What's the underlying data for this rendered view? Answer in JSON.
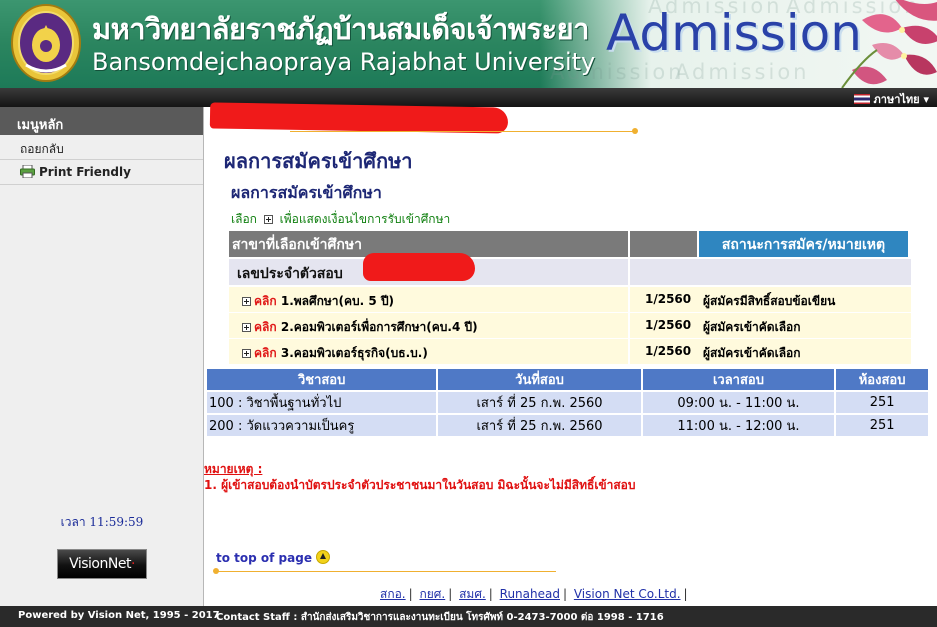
{
  "header": {
    "title_th": "มหาวิทยาลัยราชภัฏบ้านสมเด็จเจ้าพระยา",
    "title_en": "Bansomdejchaopraya Rajabhat University",
    "admission": "Admission",
    "ghost_text": "Admission"
  },
  "topbar": {
    "language": "ภาษาไทย",
    "flag_icon": "thai-flag-icon"
  },
  "sidebar": {
    "menu_heading": "เมนูหลัก",
    "back_link": "ถอยกลับ",
    "print_link": "Print Friendly",
    "clock": "เวลา 11:59:59",
    "vision_logo": "VisionNet"
  },
  "main": {
    "page_title": "ผลการสมัครเข้าศึกษา",
    "sub_title": "ผลการสมัครเข้าศึกษา",
    "select_prefix": "เลือก",
    "select_suffix": "เพื่อแสดงเงื่อนไขการรับเข้าศึกษา",
    "header_major": "สาขาที่เลือกเข้าศึกษา",
    "header_status": "สถานะการสมัคร/หมายเหตุ",
    "exam_id_label": "เลขประจำตัวสอบ",
    "click_label": "คลิก",
    "choices": [
      {
        "name": "1.พลศึกษา(คบ. 5 ปี)",
        "term": "1/2560",
        "status": "ผู้สมัครมีสิทธิ์สอบข้อเขียน"
      },
      {
        "name": "2.คอมพิวเตอร์เพื่อการศึกษา(คบ.4 ปี)",
        "term": "1/2560",
        "status": "ผู้สมัครเข้าคัดเลือก"
      },
      {
        "name": "3.คอมพิวเตอร์ธุรกิจ(บธ.บ.)",
        "term": "1/2560",
        "status": "ผู้สมัครเข้าคัดเลือก"
      }
    ],
    "exam_table": {
      "headers": [
        "วิชาสอบ",
        "วันที่สอบ",
        "เวลาสอบ",
        "ห้องสอบ"
      ],
      "rows": [
        [
          "100 : วิชาพื้นฐานทั่วไป",
          "เสาร์ ที่ 25 ก.พ. 2560",
          "09:00 น. - 11:00 น.",
          "251"
        ],
        [
          "200 : วัดแววความเป็นครู",
          "เสาร์ ที่ 25 ก.พ. 2560",
          "11:00 น. - 12:00 น.",
          "251"
        ]
      ]
    },
    "note_title": "หมายเหตุ :",
    "note_1": "1. ผู้เข้าสอบต้องนำบัตรประจำตัวประชาชนมาในวันสอบ มิฉะนั้นจะไม่มีสิทธิ์เข้าสอบ",
    "top_of_page": "to top of page"
  },
  "footer": {
    "links": [
      "สกอ.",
      "กยศ.",
      "สมศ.",
      "Runahead",
      "Vision Net Co.Ltd."
    ],
    "powered": "Powered by Vision Net, 1995 - 2017",
    "contact": "Contact Staff : สำนักส่งเสริมวิชาการและงานทะเบียน โทรศัพท์ 0-2473-7000 ต่อ 1998 - 1716"
  },
  "colors": {
    "header_green": "#2c8660",
    "admission_blue": "#2a42a8",
    "title_navy": "#1d2775",
    "status_header_blue": "#2f86c0",
    "table_header_blue": "#4f79c6",
    "table_cell_blue": "#d4ddf4",
    "choice_row_yellow": "#fffadd",
    "warning_red": "#e01010"
  }
}
